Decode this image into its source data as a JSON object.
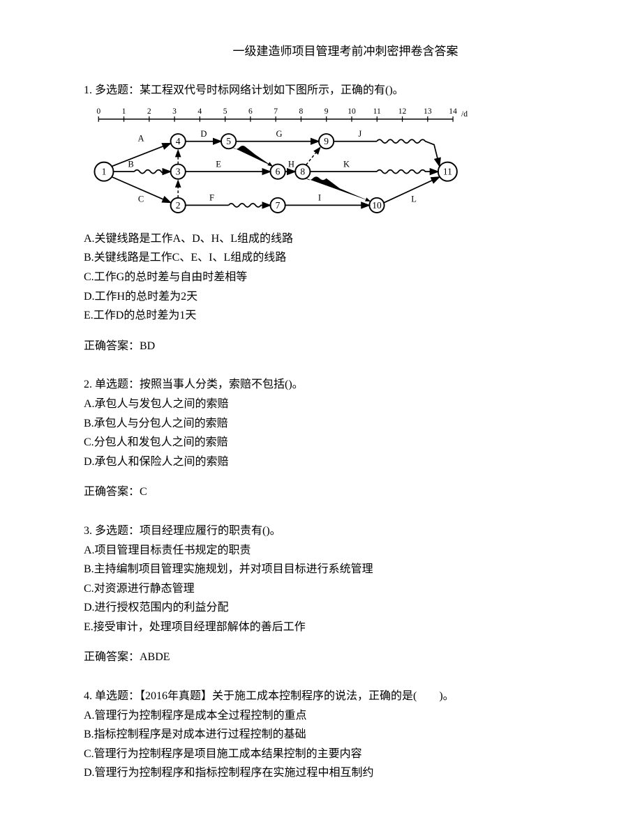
{
  "title": "一级建造师项目管理考前冲刺密押卷含答案",
  "q1": {
    "stem": "1. 多选题：某工程双代号时标网络计划如下图所示，正确的有()。",
    "axis_unit": "/d",
    "ticks": [
      "0",
      "1",
      "2",
      "3",
      "4",
      "5",
      "6",
      "7",
      "8",
      "9",
      "10",
      "11",
      "12",
      "13",
      "14"
    ],
    "optA": "A.关键线路是工作A、D、H、L组成的线路",
    "optB": "B.关键线路是工作C、E、I、L组成的线路",
    "optC": "C.工作G的总时差与自由时差相等",
    "optD": "D.工作H的总时差为2天",
    "optE": "E.工作D的总时差为1天",
    "answer": "正确答案：BD"
  },
  "q2": {
    "stem": "2. 单选题：按照当事人分类，索赔不包括()。",
    "optA": "A.承包人与发包人之间的索赔",
    "optB": "B.承包人与分包人之间的索赔",
    "optC": "C.分包人和发包人之间的索赔",
    "optD": "D.承包人和保险人之间的索赔",
    "answer": "正确答案：C"
  },
  "q3": {
    "stem": "3. 多选题：项目经理应履行的职责有()。",
    "optA": "A.项目管理目标责任书规定的职责",
    "optB": "B.主持编制项目管理实施规划，并对项目目标进行系统管理",
    "optC": "C.对资源进行静态管理",
    "optD": "D.进行授权范围内的利益分配",
    "optE": "E.接受审计，处理项目经理部解体的善后工作",
    "answer": "正确答案：ABDE"
  },
  "q4": {
    "stem": "4. 单选题：【2016年真题】关于施工成本控制程序的说法，正确的是(　　)。",
    "optA": "A.管理行为控制程序是成本全过程控制的重点",
    "optB": "B.指标控制程序是对成本进行过程控制的基础",
    "optC": "C.管理行为控制程序是项目施工成本结果控制的主要内容",
    "optD": "D.管理行为控制程序和指标控制程序在实施过程中相互制约"
  },
  "chart_data": {
    "type": "network",
    "title": "双代号时标网络计划",
    "x_unit": "d",
    "x_range": [
      0,
      14
    ],
    "nodes": [
      {
        "id": 1,
        "time": 0
      },
      {
        "id": 2,
        "time": 3
      },
      {
        "id": 3,
        "time": 3
      },
      {
        "id": 4,
        "time": 3
      },
      {
        "id": 5,
        "time": 5
      },
      {
        "id": 6,
        "time": 7
      },
      {
        "id": 7,
        "time": 7
      },
      {
        "id": 8,
        "time": 8
      },
      {
        "id": 9,
        "time": 9
      },
      {
        "id": 10,
        "time": 11
      },
      {
        "id": 11,
        "time": 14
      }
    ],
    "activities": [
      {
        "name": "A",
        "from": 1,
        "to": 4,
        "duration": 3,
        "free_float": 0
      },
      {
        "name": "B",
        "from": 1,
        "to": 3,
        "duration": 1,
        "free_float": 2
      },
      {
        "name": "C",
        "from": 1,
        "to": 2,
        "duration": 3,
        "free_float": 0
      },
      {
        "name": "D",
        "from": 4,
        "to": 5,
        "duration": 2,
        "free_float": 0
      },
      {
        "name": "E",
        "from": 3,
        "to": 6,
        "duration": 4,
        "free_float": 0
      },
      {
        "name": "F",
        "from": 2,
        "to": 7,
        "duration": 2,
        "free_float": 2
      },
      {
        "name": "G",
        "from": 5,
        "to": 9,
        "duration": 4,
        "free_float": 0
      },
      {
        "name": "H",
        "from": 6,
        "to": 8,
        "duration": 1,
        "free_float": 0
      },
      {
        "name": "I",
        "from": 7,
        "to": 10,
        "duration": 4,
        "free_float": 0
      },
      {
        "name": "J",
        "from": 9,
        "to": 11,
        "duration": 2,
        "free_float": 3
      },
      {
        "name": "K",
        "from": 8,
        "to": 11,
        "duration": 3,
        "free_float": 3
      },
      {
        "name": "L",
        "from": 10,
        "to": 11,
        "duration": 3,
        "free_float": 0
      }
    ],
    "dummies": [
      {
        "from": 2,
        "to": 3
      },
      {
        "from": 3,
        "to": 4
      },
      {
        "from": 5,
        "to": 6
      },
      {
        "from": 8,
        "to": 9
      },
      {
        "from": 8,
        "to": 10
      }
    ]
  }
}
